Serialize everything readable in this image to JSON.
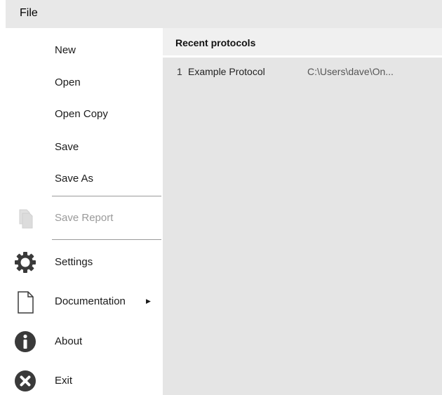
{
  "file_tab": {
    "label": "File"
  },
  "menu": {
    "items": [
      {
        "label": "New"
      },
      {
        "label": "Open"
      },
      {
        "label": "Open Copy"
      },
      {
        "label": "Save"
      },
      {
        "label": "Save As"
      },
      {
        "label": "Save Report",
        "icon": "document-copy-icon",
        "disabled": true
      },
      {
        "label": "Settings",
        "icon": "gear-icon"
      },
      {
        "label": "Documentation",
        "icon": "document-icon",
        "has_submenu": true,
        "submenu_indicator": "▶"
      },
      {
        "label": "About",
        "icon": "info-icon"
      },
      {
        "label": "Exit",
        "icon": "close-circle-icon"
      }
    ]
  },
  "recent": {
    "title": "Recent protocols",
    "items": [
      {
        "index": "1",
        "name": "Example Protocol",
        "path": "C:\\Users\\dave\\On..."
      }
    ]
  },
  "colors": {
    "top_bar": "#e8e8e8",
    "content_bg": "#e5e5e5",
    "header_bg": "#f0f0f0",
    "icon_dark": "#3a3a3a",
    "disabled_text": "#9a9a9a"
  }
}
